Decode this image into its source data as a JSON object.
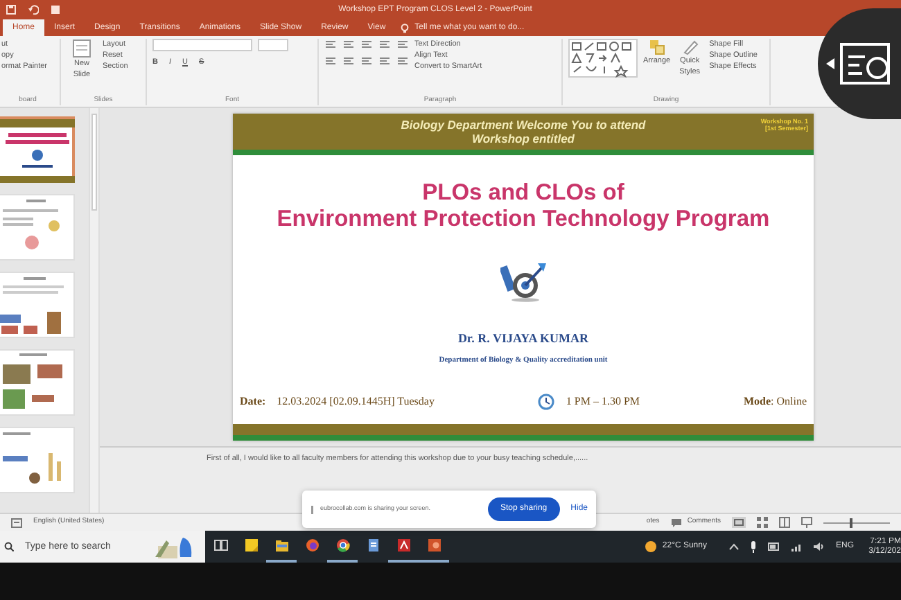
{
  "window": {
    "title": "Workshop EPT Program CLOS Level 2 - PowerPoint"
  },
  "ribbon_tabs": [
    {
      "label": "Home",
      "selected": true
    },
    {
      "label": "Insert",
      "selected": false
    },
    {
      "label": "Design",
      "selected": false
    },
    {
      "label": "Transitions",
      "selected": false
    },
    {
      "label": "Animations",
      "selected": false
    },
    {
      "label": "Slide Show",
      "selected": false
    },
    {
      "label": "Review",
      "selected": false
    },
    {
      "label": "View",
      "selected": false
    }
  ],
  "tell_me": "Tell me what you want to do...",
  "ribbon_groups": [
    {
      "kind": "list",
      "label": "board",
      "commands": [
        "ut",
        "opy",
        "ormat Painter"
      ]
    },
    {
      "kind": "slides",
      "label": "Slides",
      "commands": [
        "New Slide",
        "Layout",
        "Reset",
        "Section"
      ]
    },
    {
      "kind": "font",
      "label": "Font",
      "commands": [
        "B",
        "I",
        "U",
        "S"
      ]
    },
    {
      "kind": "paragraph",
      "label": "Paragraph",
      "commands": [
        "Text Direction",
        "Align Text",
        "Convert to SmartArt"
      ]
    },
    {
      "kind": "drawing",
      "label": "Drawing",
      "commands": [
        "Arrange",
        "Quick Styles",
        "Shape Fill",
        "Shape Outline",
        "Shape Effects"
      ]
    }
  ],
  "thumbnails": [
    {
      "selected": true
    },
    {
      "selected": false
    },
    {
      "selected": false
    },
    {
      "selected": false
    },
    {
      "selected": false
    }
  ],
  "slide": {
    "header_lines": [
      "Biology Department Welcome You to attend",
      "Workshop entitled"
    ],
    "badge_lines": [
      "Workshop No. 1",
      "[1st Semester]"
    ],
    "title_lines": [
      "PLOs and CLOs of",
      "Environment Protection Technology Program"
    ],
    "presenter": "Dr. R. VIJAYA KUMAR",
    "department": "Department of Biology &  Quality accreditation unit",
    "date_label": "Date:",
    "date": "12.03.2024  [02.09.1445H] Tuesday",
    "time": "1 PM – 1.30 PM",
    "mode_label": "Mode",
    "mode": ": Online"
  },
  "notes": "First of all, I would like to all faculty members for attending this workshop due to your busy teaching schedule,......",
  "status_bar": {
    "language": "English (United States)",
    "notes": "otes",
    "comments": "Comments",
    "zoom": {
      "level": 0.42
    }
  },
  "share_bar": {
    "message": "eubrocollab.com is sharing your screen.",
    "stop": "Stop sharing",
    "hide": "Hide"
  },
  "taskbar": {
    "search_placeholder": "Type here to search",
    "apps": [
      {
        "kind": "task-view",
        "running": false
      },
      {
        "kind": "sticky-notes",
        "running": false
      },
      {
        "kind": "file-explorer",
        "running": true
      },
      {
        "kind": "firefox",
        "running": false
      },
      {
        "kind": "chrome",
        "running": true
      },
      {
        "kind": "notepad",
        "running": false
      },
      {
        "kind": "pdf",
        "running": true
      },
      {
        "kind": "powerpoint",
        "running": true
      }
    ],
    "weather": "22°C  Sunny",
    "language": "ENG",
    "time": "7:21 PM",
    "date": "3/12/202"
  }
}
